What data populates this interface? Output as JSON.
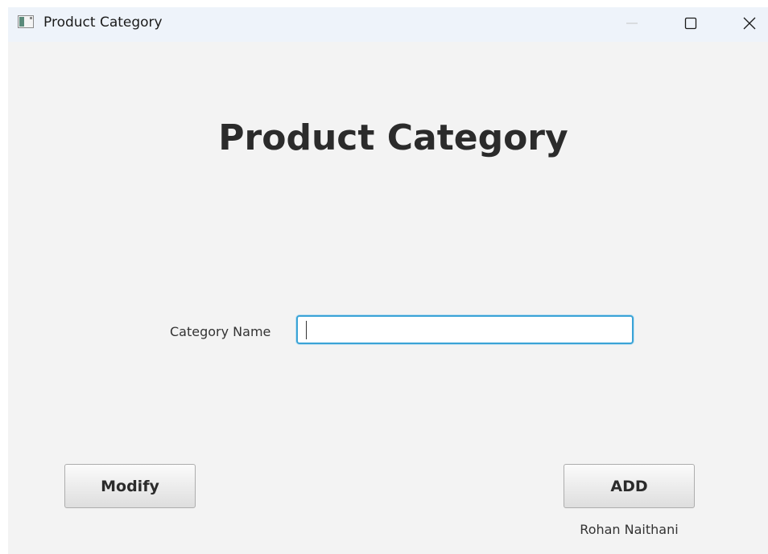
{
  "window": {
    "title": "Product Category",
    "controls": {
      "minimize_icon": "minimize-icon",
      "maximize_icon": "maximize-icon",
      "close_icon": "close-icon"
    }
  },
  "main": {
    "heading": "Product Category",
    "category_field": {
      "label": "Category Name",
      "value": "",
      "placeholder": ""
    },
    "buttons": {
      "modify_label": "Modify",
      "add_label": "ADD"
    },
    "author": "Rohan Naithani"
  },
  "colors": {
    "background": "#f3f3f3",
    "titlebar": "#eef3fa",
    "focus_border": "#3aa3d6",
    "text": "#2b2b2b"
  }
}
